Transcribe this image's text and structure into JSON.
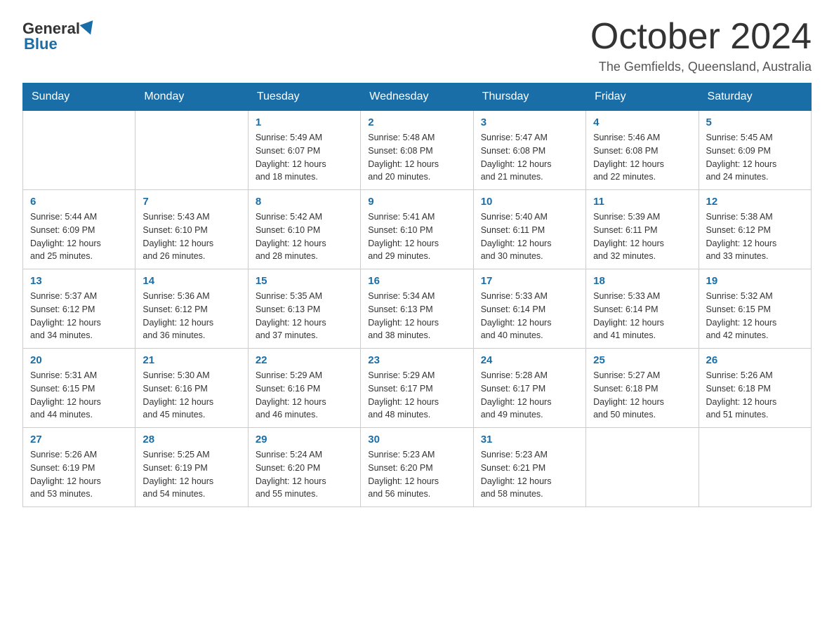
{
  "logo": {
    "general": "General",
    "blue": "Blue"
  },
  "header": {
    "title": "October 2024",
    "location": "The Gemfields, Queensland, Australia"
  },
  "days_of_week": [
    "Sunday",
    "Monday",
    "Tuesday",
    "Wednesday",
    "Thursday",
    "Friday",
    "Saturday"
  ],
  "weeks": [
    [
      {
        "day": "",
        "info": ""
      },
      {
        "day": "",
        "info": ""
      },
      {
        "day": "1",
        "info": "Sunrise: 5:49 AM\nSunset: 6:07 PM\nDaylight: 12 hours\nand 18 minutes."
      },
      {
        "day": "2",
        "info": "Sunrise: 5:48 AM\nSunset: 6:08 PM\nDaylight: 12 hours\nand 20 minutes."
      },
      {
        "day": "3",
        "info": "Sunrise: 5:47 AM\nSunset: 6:08 PM\nDaylight: 12 hours\nand 21 minutes."
      },
      {
        "day": "4",
        "info": "Sunrise: 5:46 AM\nSunset: 6:08 PM\nDaylight: 12 hours\nand 22 minutes."
      },
      {
        "day": "5",
        "info": "Sunrise: 5:45 AM\nSunset: 6:09 PM\nDaylight: 12 hours\nand 24 minutes."
      }
    ],
    [
      {
        "day": "6",
        "info": "Sunrise: 5:44 AM\nSunset: 6:09 PM\nDaylight: 12 hours\nand 25 minutes."
      },
      {
        "day": "7",
        "info": "Sunrise: 5:43 AM\nSunset: 6:10 PM\nDaylight: 12 hours\nand 26 minutes."
      },
      {
        "day": "8",
        "info": "Sunrise: 5:42 AM\nSunset: 6:10 PM\nDaylight: 12 hours\nand 28 minutes."
      },
      {
        "day": "9",
        "info": "Sunrise: 5:41 AM\nSunset: 6:10 PM\nDaylight: 12 hours\nand 29 minutes."
      },
      {
        "day": "10",
        "info": "Sunrise: 5:40 AM\nSunset: 6:11 PM\nDaylight: 12 hours\nand 30 minutes."
      },
      {
        "day": "11",
        "info": "Sunrise: 5:39 AM\nSunset: 6:11 PM\nDaylight: 12 hours\nand 32 minutes."
      },
      {
        "day": "12",
        "info": "Sunrise: 5:38 AM\nSunset: 6:12 PM\nDaylight: 12 hours\nand 33 minutes."
      }
    ],
    [
      {
        "day": "13",
        "info": "Sunrise: 5:37 AM\nSunset: 6:12 PM\nDaylight: 12 hours\nand 34 minutes."
      },
      {
        "day": "14",
        "info": "Sunrise: 5:36 AM\nSunset: 6:12 PM\nDaylight: 12 hours\nand 36 minutes."
      },
      {
        "day": "15",
        "info": "Sunrise: 5:35 AM\nSunset: 6:13 PM\nDaylight: 12 hours\nand 37 minutes."
      },
      {
        "day": "16",
        "info": "Sunrise: 5:34 AM\nSunset: 6:13 PM\nDaylight: 12 hours\nand 38 minutes."
      },
      {
        "day": "17",
        "info": "Sunrise: 5:33 AM\nSunset: 6:14 PM\nDaylight: 12 hours\nand 40 minutes."
      },
      {
        "day": "18",
        "info": "Sunrise: 5:33 AM\nSunset: 6:14 PM\nDaylight: 12 hours\nand 41 minutes."
      },
      {
        "day": "19",
        "info": "Sunrise: 5:32 AM\nSunset: 6:15 PM\nDaylight: 12 hours\nand 42 minutes."
      }
    ],
    [
      {
        "day": "20",
        "info": "Sunrise: 5:31 AM\nSunset: 6:15 PM\nDaylight: 12 hours\nand 44 minutes."
      },
      {
        "day": "21",
        "info": "Sunrise: 5:30 AM\nSunset: 6:16 PM\nDaylight: 12 hours\nand 45 minutes."
      },
      {
        "day": "22",
        "info": "Sunrise: 5:29 AM\nSunset: 6:16 PM\nDaylight: 12 hours\nand 46 minutes."
      },
      {
        "day": "23",
        "info": "Sunrise: 5:29 AM\nSunset: 6:17 PM\nDaylight: 12 hours\nand 48 minutes."
      },
      {
        "day": "24",
        "info": "Sunrise: 5:28 AM\nSunset: 6:17 PM\nDaylight: 12 hours\nand 49 minutes."
      },
      {
        "day": "25",
        "info": "Sunrise: 5:27 AM\nSunset: 6:18 PM\nDaylight: 12 hours\nand 50 minutes."
      },
      {
        "day": "26",
        "info": "Sunrise: 5:26 AM\nSunset: 6:18 PM\nDaylight: 12 hours\nand 51 minutes."
      }
    ],
    [
      {
        "day": "27",
        "info": "Sunrise: 5:26 AM\nSunset: 6:19 PM\nDaylight: 12 hours\nand 53 minutes."
      },
      {
        "day": "28",
        "info": "Sunrise: 5:25 AM\nSunset: 6:19 PM\nDaylight: 12 hours\nand 54 minutes."
      },
      {
        "day": "29",
        "info": "Sunrise: 5:24 AM\nSunset: 6:20 PM\nDaylight: 12 hours\nand 55 minutes."
      },
      {
        "day": "30",
        "info": "Sunrise: 5:23 AM\nSunset: 6:20 PM\nDaylight: 12 hours\nand 56 minutes."
      },
      {
        "day": "31",
        "info": "Sunrise: 5:23 AM\nSunset: 6:21 PM\nDaylight: 12 hours\nand 58 minutes."
      },
      {
        "day": "",
        "info": ""
      },
      {
        "day": "",
        "info": ""
      }
    ]
  ]
}
